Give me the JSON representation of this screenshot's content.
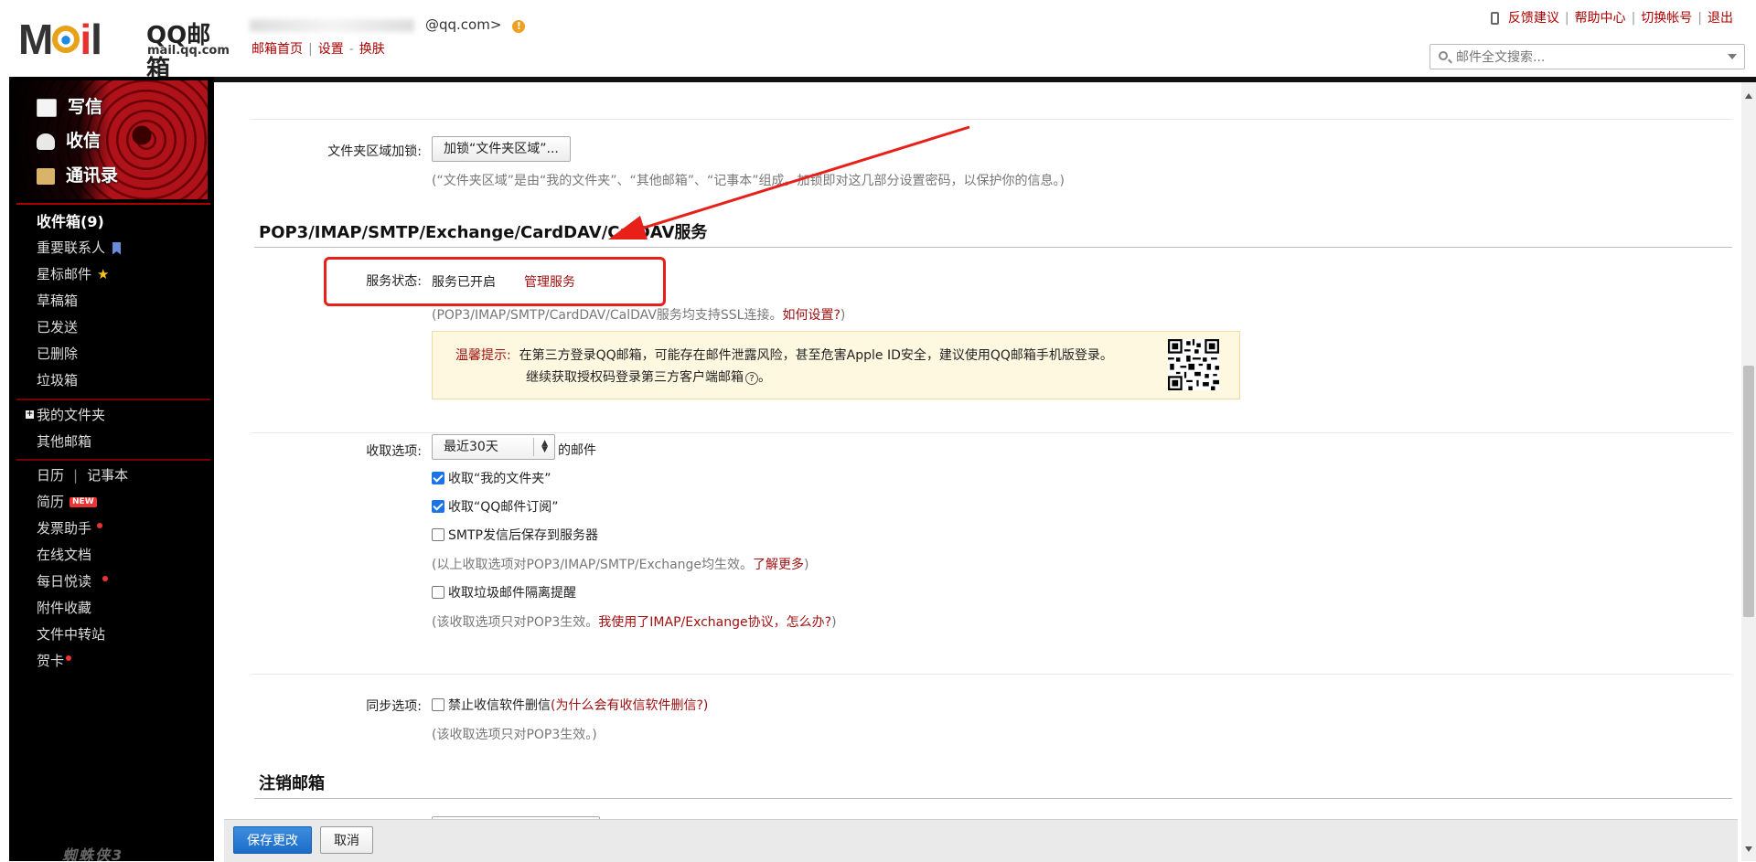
{
  "header": {
    "logo_text": "MOil",
    "logo_brand": "QQ邮箱",
    "logo_domain": "mail.qq.com",
    "account_email_suffix": "@qq.com>",
    "nav": {
      "home": "邮箱首页",
      "settings": "设置",
      "sep": "-",
      "skin": "换肤"
    },
    "top_links": [
      "反馈建议",
      "帮助中心",
      "切换帐号",
      "退出"
    ],
    "search_placeholder": "邮件全文搜索..."
  },
  "sidebar": {
    "compose": {
      "write": "写信",
      "inbox": "收信",
      "contacts": "通讯录"
    },
    "folders": [
      {
        "label": "收件箱(9)"
      },
      {
        "label": "重要联系人"
      },
      {
        "label": "星标邮件"
      },
      {
        "label": "草稿箱"
      },
      {
        "label": "已发送"
      },
      {
        "label": "已删除"
      },
      {
        "label": "垃圾箱"
      }
    ],
    "my_folders": "我的文件夹",
    "other_mailbox": "其他邮箱",
    "apps": {
      "calendar": "日历",
      "notebook": "记事本",
      "resume": "简历",
      "new_badge": "NEW",
      "invoice": "发票助手",
      "docs": "在线文档",
      "daily_read": "每日悦读",
      "attachments": "附件收藏",
      "file_transfer": "文件中转站",
      "cards": "贺卡"
    },
    "bottom_text": "蜘蛛侠3"
  },
  "main": {
    "folder_lock": {
      "label": "文件夹区域加锁:",
      "button": "加锁“文件夹区域”...",
      "note": "(“文件夹区域”是由“我的文件夹”、“其他邮箱”、“记事本”组成。加锁即对这几部分设置密码，以保护你的信息。)"
    },
    "pop_section": {
      "title": "POP3/IMAP/SMTP/Exchange/CardDAV/CalDAV服务",
      "status_label": "服务状态:",
      "status_value": "服务已开启",
      "manage_link": "管理服务",
      "ssl_note_prefix": "(POP3/IMAP/SMTP/CardDAV/CalDAV服务均支持SSL连接。",
      "ssl_note_link": "如何设置?",
      "ssl_note_suffix": ")",
      "tip_label": "温馨提示:",
      "tip_line1": "在第三方登录QQ邮箱，可能存在邮件泄露风险，甚至危害Apple ID安全，建议使用QQ邮箱手机版登录。",
      "tip_line2": "继续获取授权码登录第三方客户端邮箱"
    },
    "receive": {
      "label": "收取选项:",
      "select_value": "最近30天",
      "select_suffix": "的邮件",
      "opt_my_folders": "收取“我的文件夹”",
      "opt_subscriptions": "收取“QQ邮件订阅”",
      "opt_smtp_save": "SMTP发信后保存到服务器",
      "note1_prefix": "(以上收取选项对POP3/IMAP/SMTP/Exchange均生效。",
      "note1_link": "了解更多",
      "note1_suffix": ")",
      "opt_spam": "收取垃圾邮件隔离提醒",
      "note2_prefix": "(该收取选项只对POP3生效。",
      "note2_link": "我使用了IMAP/Exchange协议，怎么办?",
      "note2_suffix": ")"
    },
    "sync": {
      "label": "同步选项:",
      "opt_no_delete": "禁止收信软件删信",
      "opt_link": "(为什么会有收信软件删信?)",
      "note": "(该收取选项只对POP3生效。)"
    },
    "cancel_section": {
      "title": "注销邮箱"
    }
  },
  "footer": {
    "save": "保存更改",
    "cancel": "取消"
  },
  "colors": {
    "accent_red": "#a01010",
    "primary_blue": "#1b6cc6",
    "annotation_red": "#e8201a"
  }
}
